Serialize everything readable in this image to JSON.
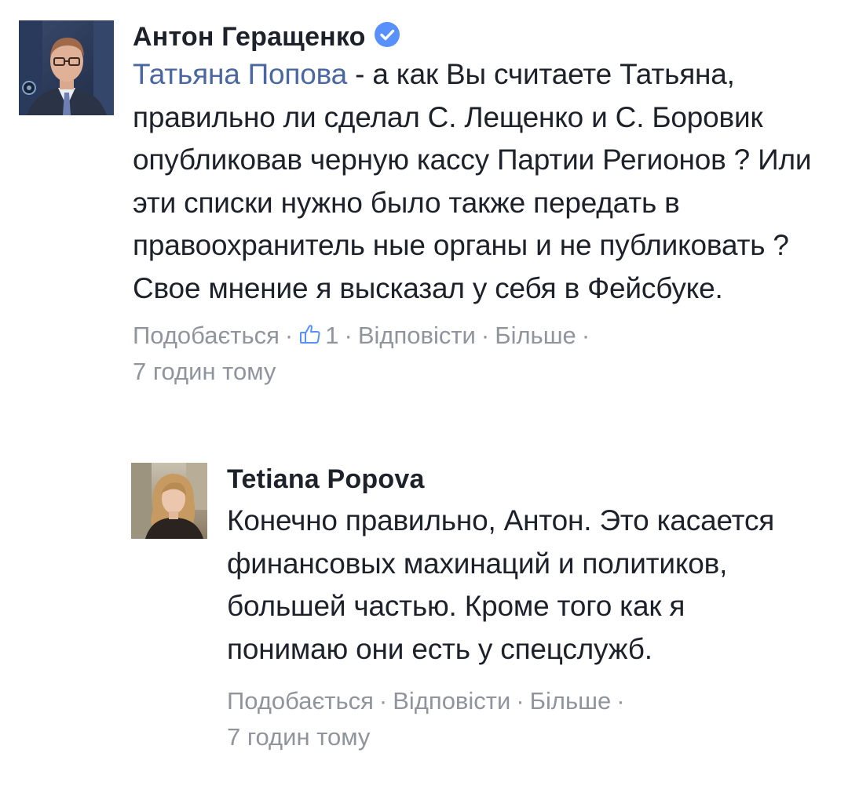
{
  "comments": [
    {
      "author": "Антон Геращенко",
      "verified": true,
      "mention": "Татьяна Попова",
      "text": " - а как Вы считаете Татьяна, правильно ли сделал С. Лещенко и С. Боровик опубликовав черную кассу Партии Регионов ? Или эти списки нужно было также передать в правоохранитель ные органы и не публиковать ? Свое мнение я высказал у себя в Фейсбуке.",
      "like_label": "Подобається",
      "like_count": "1",
      "reply_label": "Відповісти",
      "more_label": "Більше",
      "time": "7 годин тому"
    }
  ],
  "reply": {
    "author": "Tetiana Popova",
    "text": "Конечно правильно, Антон. Это касается финансовых махинаций и политиков, большей частью. Кроме того как я понимаю они есть у спецслужб.",
    "like_label": "Подобається",
    "reply_label": "Відповісти",
    "more_label": "Більше",
    "time": "7 годин тому"
  },
  "separator": "·",
  "colors": {
    "link": "#4b67a1",
    "meta": "#90949c",
    "text": "#1d2129",
    "verified": "#5890ff"
  }
}
